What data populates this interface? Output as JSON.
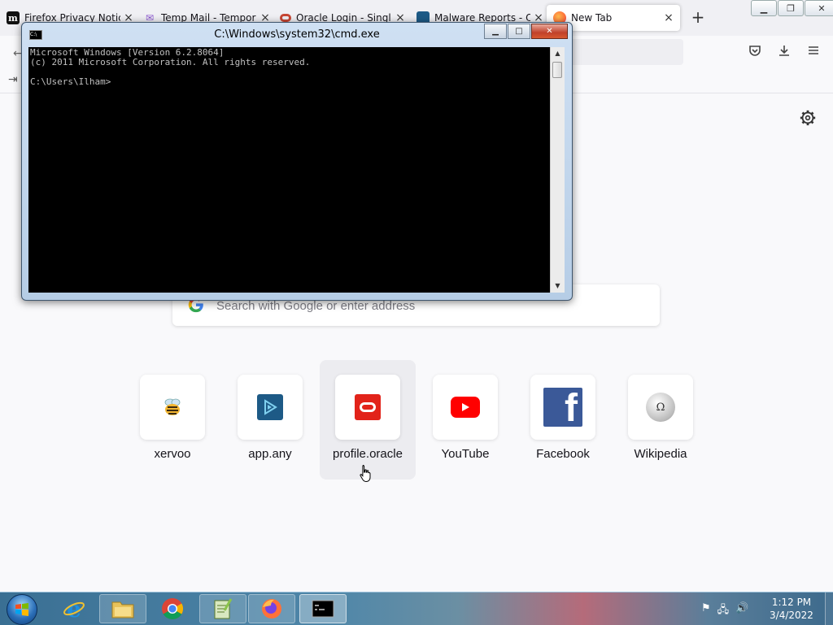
{
  "browser": {
    "tabs": [
      {
        "title": "Firefox Privacy Notic",
        "favicon": "mozilla-m-icon",
        "active": false
      },
      {
        "title": "Temp Mail - Tempor",
        "favicon": "temp-mail-icon",
        "active": false
      },
      {
        "title": "Oracle Login - Singl",
        "favicon": "oracle-icon",
        "active": false
      },
      {
        "title": "Malware Reports - O",
        "favicon": "any-run-icon",
        "active": false
      },
      {
        "title": "New Tab",
        "favicon": "firefox-icon",
        "active": true
      }
    ],
    "new_tab_glyph": "+",
    "close_glyph": "×"
  },
  "newtab": {
    "search": {
      "placeholder": "Search with Google or enter address",
      "value": ""
    },
    "shortcuts": [
      {
        "label": "xervoo",
        "icon": "bee-icon"
      },
      {
        "label": "app.any",
        "icon": "any-run-icon"
      },
      {
        "label": "profile.oracle",
        "icon": "oracle-icon"
      },
      {
        "label": "YouTube",
        "icon": "youtube-icon"
      },
      {
        "label": "Facebook",
        "icon": "facebook-icon"
      },
      {
        "label": "Wikipedia",
        "icon": "wikipedia-icon"
      }
    ],
    "hovered_shortcut": "profile.oracle"
  },
  "cmd": {
    "title": "C:\\Windows\\system32\\cmd.exe",
    "output": "Microsoft Windows [Version 6.2.8064]\n(c) 2011 Microsoft Corporation. All rights reserved.\n\nC:\\Users\\Ilham>"
  },
  "taskbar": {
    "items": [
      "internet-explorer-icon",
      "file-explorer-icon",
      "chrome-icon",
      "notepad-plus-plus-icon",
      "firefox-icon",
      "cmd-icon"
    ],
    "active_item": "cmd-icon",
    "clock": {
      "time": "1:12 PM",
      "date": "3/4/2022"
    }
  },
  "colors": {
    "firefox_bg": "#f9f9fb",
    "cmd_bg": "#000000",
    "cmd_text": "#c0c0c0",
    "oracle_red": "#e2231a",
    "youtube_red": "#ff0000",
    "facebook_blue": "#3b5998"
  }
}
